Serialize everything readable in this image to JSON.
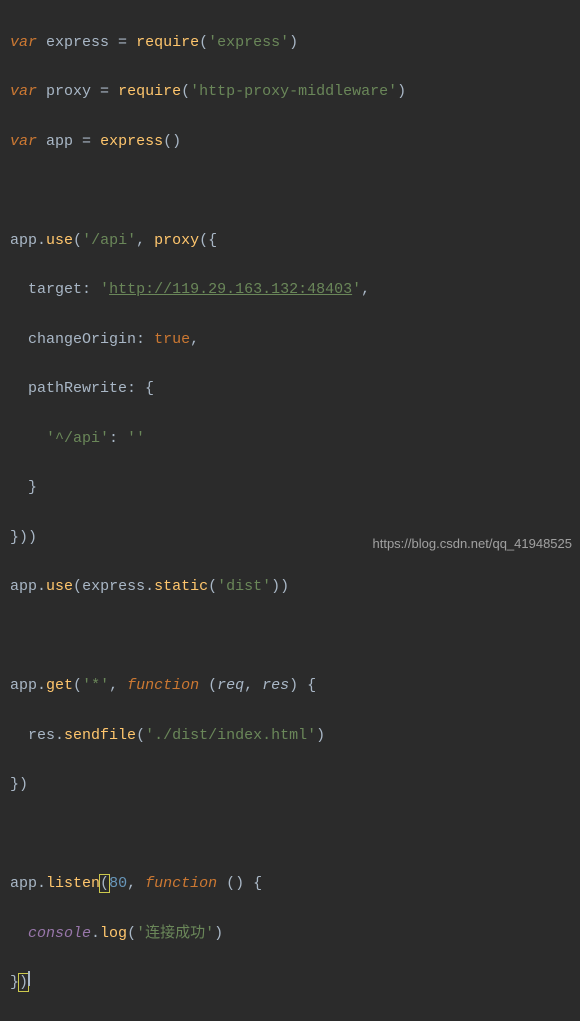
{
  "code": {
    "l1": {
      "var": "var",
      "sp": " ",
      "express": "express",
      "eq": " = ",
      "require": "require",
      "op": "(",
      "str": "'express'",
      "cp": ")"
    },
    "l2": {
      "var": "var",
      "sp": " ",
      "proxy": "proxy",
      "eq": " = ",
      "require": "require",
      "op": "(",
      "str": "'http-proxy-middleware'",
      "cp": ")"
    },
    "l3": {
      "var": "var",
      "sp": " ",
      "app": "app",
      "eq": " = ",
      "express": "express",
      "op": "(",
      "cp": ")"
    },
    "l5": {
      "app": "app",
      "dot": ".",
      "use": "use",
      "op": "(",
      "str": "'/api'",
      "comma": ", ",
      "proxy": "proxy",
      "op2": "({"
    },
    "l6": {
      "indent": "  ",
      "target": "target",
      "colon": ": ",
      "q": "'",
      "url": "http://119.29.163.132:48403",
      "q2": "'",
      "comma": ","
    },
    "l7": {
      "indent": "  ",
      "changeOrigin": "changeOrigin",
      "colon": ": ",
      "true": "true",
      "comma": ","
    },
    "l8": {
      "indent": "  ",
      "pathRewrite": "pathRewrite",
      "colon": ": {"
    },
    "l9": {
      "indent": "    ",
      "key": "'^/api'",
      "colon": ": ",
      "val": "''"
    },
    "l10": {
      "indent": "  ",
      "cb": "}"
    },
    "l11": {
      "cb": "}))"
    },
    "l12": {
      "app": "app",
      "dot": ".",
      "use": "use",
      "op": "(",
      "express": "express",
      "dot2": ".",
      "static": "static",
      "op2": "(",
      "str": "'dist'",
      "cp": "))"
    },
    "l14": {
      "app": "app",
      "dot": ".",
      "get": "get",
      "op": "(",
      "str": "'*'",
      "comma": ", ",
      "function": "function",
      "sp": " (",
      "req": "req",
      "c2": ", ",
      "res": "res",
      "cp": ") {"
    },
    "l15": {
      "indent": "  ",
      "res": "res",
      "dot": ".",
      "sendfile": "sendfile",
      "op": "(",
      "str": "'./dist/index.html'",
      "cp": ")"
    },
    "l16": {
      "cb": "})"
    },
    "l18": {
      "app": "app",
      "dot": ".",
      "listen": "listen",
      "op": "(",
      "num": "80",
      "comma": ", ",
      "function": "function",
      "sp": " () {"
    },
    "l19": {
      "indent": "  ",
      "console": "console",
      "dot": ".",
      "log": "log",
      "op": "(",
      "str": "'连接成功'",
      "cp": ")"
    },
    "l20": {
      "cb": "})"
    }
  },
  "watermark": "https://blog.csdn.net/qq_41948525"
}
